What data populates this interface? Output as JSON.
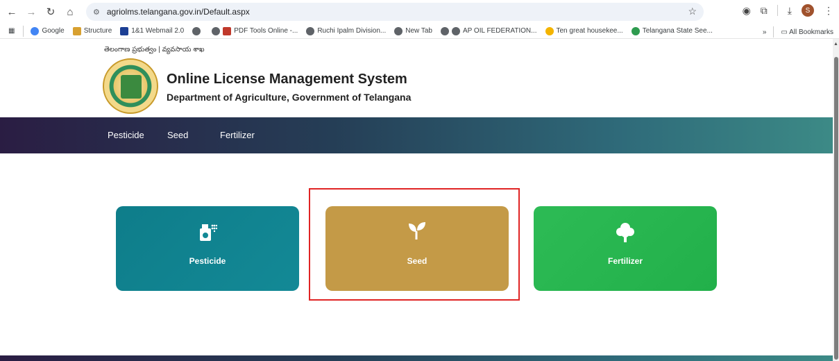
{
  "browser": {
    "url": "agriolms.telangana.gov.in/Default.aspx",
    "avatar_letter": "S",
    "bookmarks": [
      {
        "label": "Google"
      },
      {
        "label": "Structure"
      },
      {
        "label": "1&1 Webmail 2.0"
      },
      {
        "label": ""
      },
      {
        "label": "PDF Tools Online -..."
      },
      {
        "label": "Ruchi Ipalm Division..."
      },
      {
        "label": "New Tab"
      },
      {
        "label": "AP OIL FEDERATION..."
      },
      {
        "label": "Ten great housekee..."
      },
      {
        "label": "Telangana State See..."
      }
    ],
    "bookmarks_more": "»",
    "all_bookmarks": "All Bookmarks"
  },
  "header": {
    "telugu_text": "తెలంగాణ ప్రభుత్వం | వ్యవసాయ శాఖ",
    "title": "Online License Management System",
    "subtitle": "Department of Agriculture, Government of Telangana"
  },
  "nav": {
    "items": [
      {
        "label": "Pesticide"
      },
      {
        "label": "Seed"
      },
      {
        "label": "Fertilizer"
      }
    ]
  },
  "cards": [
    {
      "label": "Pesticide",
      "icon": "spray-bottle-icon",
      "color": "#0e7d8a"
    },
    {
      "label": "Seed",
      "icon": "seedling-icon",
      "color": "#c49a47"
    },
    {
      "label": "Fertilizer",
      "icon": "tree-icon",
      "color": "#22b04a"
    }
  ],
  "highlight_color": "#e02424"
}
